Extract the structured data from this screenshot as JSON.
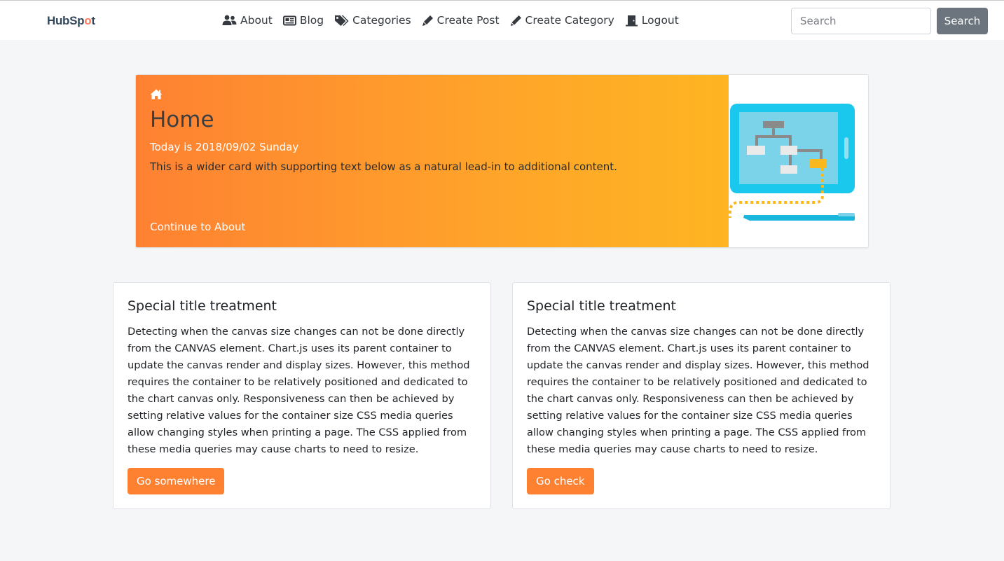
{
  "brand": {
    "logo_prefix": "HubSp",
    "logo_mid": "o",
    "logo_suffix": "t",
    "accent": "#ff7a59"
  },
  "nav": {
    "items": [
      {
        "label": "About",
        "icon": "users-icon"
      },
      {
        "label": "Blog",
        "icon": "newspaper-icon"
      },
      {
        "label": "Categories",
        "icon": "tags-icon"
      },
      {
        "label": "Create Post",
        "icon": "pen-icon"
      },
      {
        "label": "Create Category",
        "icon": "pencil-icon"
      },
      {
        "label": "Logout",
        "icon": "door-icon"
      }
    ]
  },
  "search": {
    "placeholder": "Search",
    "value": "",
    "button_label": "Search"
  },
  "hero": {
    "title": "Home",
    "date_text": "Today is 2018/09/02 Sunday",
    "lead": "This is a wider card with supporting text below as a natural lead-in to additional content.",
    "link": "Continue to About",
    "gradient_start": "#fe8132",
    "gradient_end": "#feb522"
  },
  "cards": [
    {
      "title": "Special title treatment",
      "text": "Detecting when the canvas size changes can not be done directly from the CANVAS element. Chart.js uses its parent container to update the canvas render and display sizes. However, this method requires the container to be relatively positioned and dedicated to the chart canvas only. Responsiveness can then be achieved by setting relative values for the container size CSS media queries allow changing styles when printing a page. The CSS applied from these media queries may cause charts to need to resize.",
      "button": "Go somewhere"
    },
    {
      "title": "Special title treatment",
      "text": "Detecting when the canvas size changes can not be done directly from the CANVAS element. Chart.js uses its parent container to update the canvas render and display sizes. However, this method requires the container to be relatively positioned and dedicated to the chart canvas only. Responsiveness can then be achieved by setting relative values for the container size CSS media queries allow changing styles when printing a page. The CSS applied from these media queries may cause charts to need to resize.",
      "button": "Go check"
    }
  ],
  "colors": {
    "button_primary": "#fe8132",
    "button_secondary": "#6c757d",
    "background": "#f5f6f8"
  }
}
